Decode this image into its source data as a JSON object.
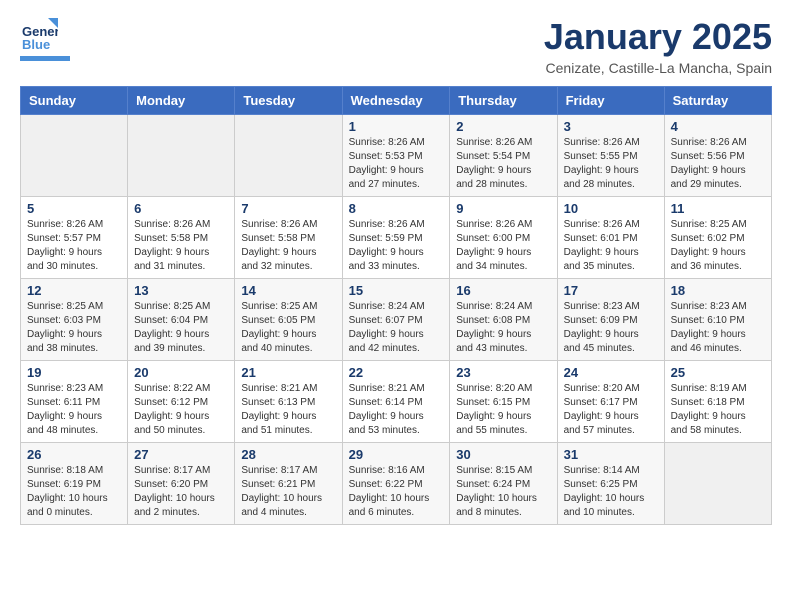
{
  "header": {
    "logo": {
      "line1": "General",
      "line2": "Blue"
    },
    "title": "January 2025",
    "subtitle": "Cenizate, Castille-La Mancha, Spain"
  },
  "calendar": {
    "days_of_week": [
      "Sunday",
      "Monday",
      "Tuesday",
      "Wednesday",
      "Thursday",
      "Friday",
      "Saturday"
    ],
    "weeks": [
      [
        {
          "day": "",
          "info": ""
        },
        {
          "day": "",
          "info": ""
        },
        {
          "day": "",
          "info": ""
        },
        {
          "day": "1",
          "info": "Sunrise: 8:26 AM\nSunset: 5:53 PM\nDaylight: 9 hours\nand 27 minutes."
        },
        {
          "day": "2",
          "info": "Sunrise: 8:26 AM\nSunset: 5:54 PM\nDaylight: 9 hours\nand 28 minutes."
        },
        {
          "day": "3",
          "info": "Sunrise: 8:26 AM\nSunset: 5:55 PM\nDaylight: 9 hours\nand 28 minutes."
        },
        {
          "day": "4",
          "info": "Sunrise: 8:26 AM\nSunset: 5:56 PM\nDaylight: 9 hours\nand 29 minutes."
        }
      ],
      [
        {
          "day": "5",
          "info": "Sunrise: 8:26 AM\nSunset: 5:57 PM\nDaylight: 9 hours\nand 30 minutes."
        },
        {
          "day": "6",
          "info": "Sunrise: 8:26 AM\nSunset: 5:58 PM\nDaylight: 9 hours\nand 31 minutes."
        },
        {
          "day": "7",
          "info": "Sunrise: 8:26 AM\nSunset: 5:58 PM\nDaylight: 9 hours\nand 32 minutes."
        },
        {
          "day": "8",
          "info": "Sunrise: 8:26 AM\nSunset: 5:59 PM\nDaylight: 9 hours\nand 33 minutes."
        },
        {
          "day": "9",
          "info": "Sunrise: 8:26 AM\nSunset: 6:00 PM\nDaylight: 9 hours\nand 34 minutes."
        },
        {
          "day": "10",
          "info": "Sunrise: 8:26 AM\nSunset: 6:01 PM\nDaylight: 9 hours\nand 35 minutes."
        },
        {
          "day": "11",
          "info": "Sunrise: 8:25 AM\nSunset: 6:02 PM\nDaylight: 9 hours\nand 36 minutes."
        }
      ],
      [
        {
          "day": "12",
          "info": "Sunrise: 8:25 AM\nSunset: 6:03 PM\nDaylight: 9 hours\nand 38 minutes."
        },
        {
          "day": "13",
          "info": "Sunrise: 8:25 AM\nSunset: 6:04 PM\nDaylight: 9 hours\nand 39 minutes."
        },
        {
          "day": "14",
          "info": "Sunrise: 8:25 AM\nSunset: 6:05 PM\nDaylight: 9 hours\nand 40 minutes."
        },
        {
          "day": "15",
          "info": "Sunrise: 8:24 AM\nSunset: 6:07 PM\nDaylight: 9 hours\nand 42 minutes."
        },
        {
          "day": "16",
          "info": "Sunrise: 8:24 AM\nSunset: 6:08 PM\nDaylight: 9 hours\nand 43 minutes."
        },
        {
          "day": "17",
          "info": "Sunrise: 8:23 AM\nSunset: 6:09 PM\nDaylight: 9 hours\nand 45 minutes."
        },
        {
          "day": "18",
          "info": "Sunrise: 8:23 AM\nSunset: 6:10 PM\nDaylight: 9 hours\nand 46 minutes."
        }
      ],
      [
        {
          "day": "19",
          "info": "Sunrise: 8:23 AM\nSunset: 6:11 PM\nDaylight: 9 hours\nand 48 minutes."
        },
        {
          "day": "20",
          "info": "Sunrise: 8:22 AM\nSunset: 6:12 PM\nDaylight: 9 hours\nand 50 minutes."
        },
        {
          "day": "21",
          "info": "Sunrise: 8:21 AM\nSunset: 6:13 PM\nDaylight: 9 hours\nand 51 minutes."
        },
        {
          "day": "22",
          "info": "Sunrise: 8:21 AM\nSunset: 6:14 PM\nDaylight: 9 hours\nand 53 minutes."
        },
        {
          "day": "23",
          "info": "Sunrise: 8:20 AM\nSunset: 6:15 PM\nDaylight: 9 hours\nand 55 minutes."
        },
        {
          "day": "24",
          "info": "Sunrise: 8:20 AM\nSunset: 6:17 PM\nDaylight: 9 hours\nand 57 minutes."
        },
        {
          "day": "25",
          "info": "Sunrise: 8:19 AM\nSunset: 6:18 PM\nDaylight: 9 hours\nand 58 minutes."
        }
      ],
      [
        {
          "day": "26",
          "info": "Sunrise: 8:18 AM\nSunset: 6:19 PM\nDaylight: 10 hours\nand 0 minutes."
        },
        {
          "day": "27",
          "info": "Sunrise: 8:17 AM\nSunset: 6:20 PM\nDaylight: 10 hours\nand 2 minutes."
        },
        {
          "day": "28",
          "info": "Sunrise: 8:17 AM\nSunset: 6:21 PM\nDaylight: 10 hours\nand 4 minutes."
        },
        {
          "day": "29",
          "info": "Sunrise: 8:16 AM\nSunset: 6:22 PM\nDaylight: 10 hours\nand 6 minutes."
        },
        {
          "day": "30",
          "info": "Sunrise: 8:15 AM\nSunset: 6:24 PM\nDaylight: 10 hours\nand 8 minutes."
        },
        {
          "day": "31",
          "info": "Sunrise: 8:14 AM\nSunset: 6:25 PM\nDaylight: 10 hours\nand 10 minutes."
        },
        {
          "day": "",
          "info": ""
        }
      ]
    ]
  }
}
